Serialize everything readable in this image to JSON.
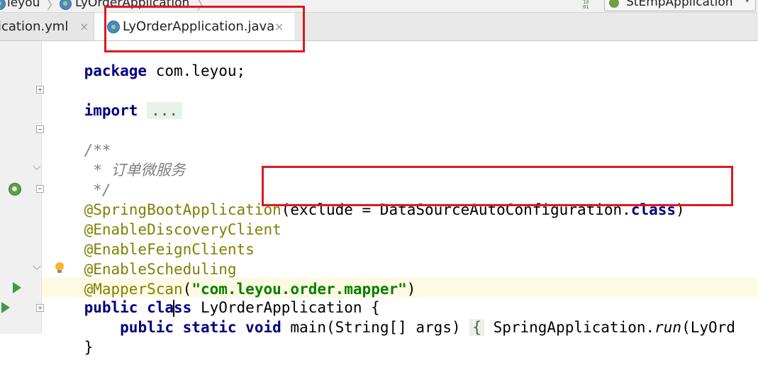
{
  "breadcrumb": {
    "items": [
      "leyou",
      "LyOrderApplication"
    ]
  },
  "run_config": {
    "label": "StEmpApplication"
  },
  "vcs_indicator": {
    "top": "10",
    "bottom": "01"
  },
  "tabs": [
    {
      "label": "lication.yml",
      "close": "×",
      "active": false
    },
    {
      "label": "LyOrderApplication.java",
      "close": "×",
      "active": true
    }
  ],
  "code": {
    "package_kw": "package",
    "package_name": " com.leyou;",
    "import_kw": "import",
    "import_folded": "...",
    "doc_open": "/**",
    "doc_text": " * 订单微服务",
    "doc_close": " */",
    "ann_spring_boot": "@SpringBootApplication",
    "ann_spring_boot_args_a": "(exclude = DataSourceAutoConfiguration.",
    "ann_spring_boot_args_kw": "class",
    "ann_spring_boot_args_b": ")",
    "ann_discovery": "@EnableDiscoveryClient",
    "ann_feign": "@EnableFeignClients",
    "ann_scheduling": "@EnableScheduling",
    "ann_mapper_at": "@",
    "ann_mapper_rest": "MapperScan",
    "ann_mapper_open": "(",
    "ann_mapper_str": "\"com.leyou.order.mapper\"",
    "ann_mapper_close": ")",
    "class_kw_a": "public",
    "class_kw_b_1": " cla",
    "class_kw_b_2": "ss",
    "class_name": " LyOrderApplication {",
    "main_kw_public": "public",
    "main_kw_static": " static",
    "main_kw_void": " void",
    "main_sig": " main(String[] args) ",
    "main_body_open": "{",
    "main_body_call": " SpringApplication.",
    "main_body_run": "run",
    "main_body_rest": "(LyOrd",
    "closing_brace": "}"
  }
}
